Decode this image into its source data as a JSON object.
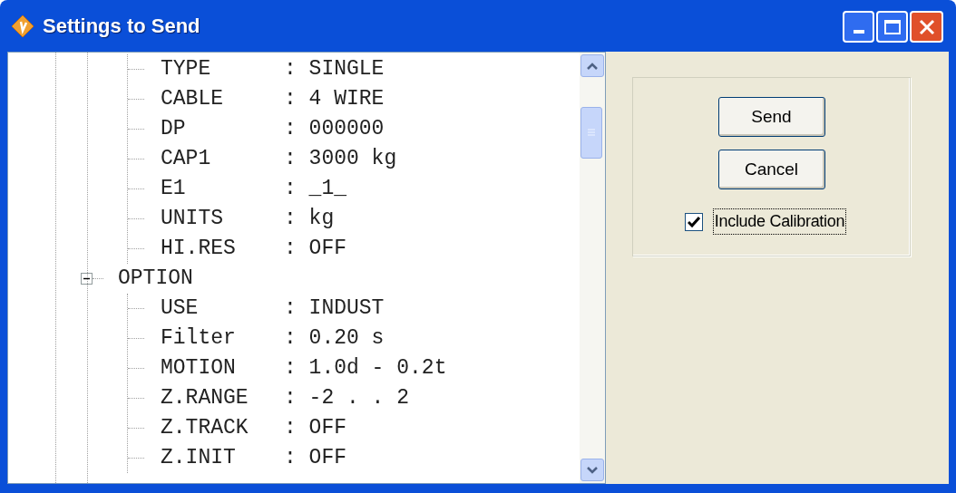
{
  "window": {
    "title": "Settings to Send"
  },
  "tree": [
    {
      "children": [
        {
          "label": "TYPE",
          "value": ": SINGLE"
        },
        {
          "label": "CABLE",
          "value": ": 4 WIRE"
        },
        {
          "label": "DP",
          "value": ": 000000"
        },
        {
          "label": "CAP1",
          "value": ": 3000 kg"
        },
        {
          "label": "E1",
          "value": ": _1_"
        },
        {
          "label": "UNITS",
          "value": ": kg"
        },
        {
          "label": "HI.RES",
          "value": ": OFF"
        }
      ]
    },
    {
      "label": "OPTION",
      "expanded": true,
      "children": [
        {
          "label": "USE",
          "value": ": INDUST"
        },
        {
          "label": "Filter",
          "value": ": 0.20 s"
        },
        {
          "label": "MOTION",
          "value": ": 1.0d - 0.2t"
        },
        {
          "label": "Z.RANGE",
          "value": ": -2 . . 2"
        },
        {
          "label": "Z.TRACK",
          "value": ": OFF"
        },
        {
          "label": "Z.INIT",
          "value": ": OFF"
        }
      ]
    }
  ],
  "buttons": [
    "Send",
    "Cancel"
  ],
  "include_calibration": {
    "label": "Include Calibration",
    "checked": true,
    "focused": true
  }
}
